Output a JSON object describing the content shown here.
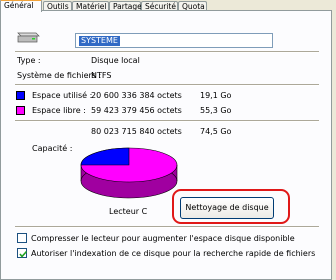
{
  "tabs": [
    "Général",
    "Outils",
    "Matériel",
    "Partage",
    "Sécurité",
    "Quota"
  ],
  "drive": {
    "name": "SYSTEME"
  },
  "info": {
    "type_label": "Type :",
    "type_value": "Disque local",
    "fs_label": "Système de fichiers :",
    "fs_value": "NTFS"
  },
  "space": {
    "used_label": "Espace utilisé :",
    "used_bytes": "20 600 336 384 octets",
    "used_size": "19,1 Go",
    "free_label": "Espace libre :",
    "free_bytes": "59 423 379 456 octets",
    "free_size": "55,3 Go",
    "capacity_label": "Capacité :",
    "capacity_bytes": "80 023 715 840 octets",
    "capacity_size": "74,5 Go",
    "used_color": "#0000ff",
    "free_color": "#ff00ff"
  },
  "pie": {
    "label": "Lecteur C",
    "used_fraction": 0.257
  },
  "buttons": {
    "cleanup": "Nettoyage de disque"
  },
  "options": {
    "compress": {
      "label": "Compresser le lecteur pour augmenter l'espace disque disponible",
      "checked": false
    },
    "index": {
      "label": "Autoriser l'indexation de ce disque pour la recherche rapide de fichiers",
      "checked": true
    }
  }
}
